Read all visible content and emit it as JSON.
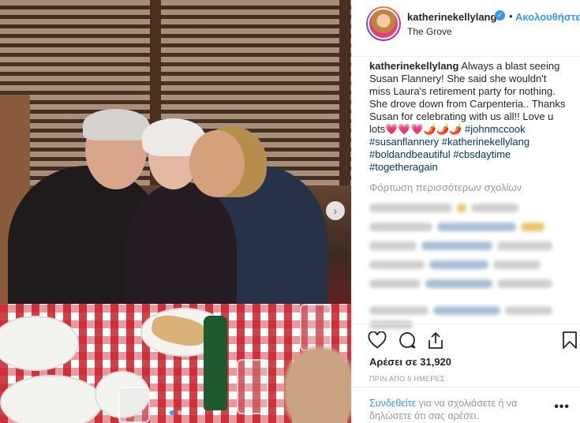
{
  "post": {
    "username": "katherinekellylang",
    "verified_mark": "✓",
    "separator": "•",
    "follow_label": "Ακολουθήστε",
    "location": "The Grove"
  },
  "caption": {
    "username": "katherinekellylang",
    "text": "Always a blast seeing Susan Flannery! She said she wouldn't miss Laura's retirement party for nothing. She drove down from Carpenteria.. Thanks Susan for celebrating with us all!! Love u lots",
    "emoji": "💗💗💗🌶️🌶️🌶️",
    "hashtags": [
      "#johnmccook",
      "#susanflannery",
      "#katherinekellylang",
      "#boldandbeautiful",
      "#cbsdaytime",
      "#togetheragain"
    ]
  },
  "comments": {
    "load_more_label": "Φόρτωση περισσότερων σχολίων"
  },
  "actions": {
    "like_icon": "heart-icon",
    "comment_icon": "comment-icon",
    "share_icon": "share-icon",
    "save_icon": "bookmark-icon"
  },
  "likes": "Αρέσει σε 31,920",
  "timestamp": "ΠΡΙΝ ΑΠΟ 5 ΗΜΕΡΕΣ",
  "login": {
    "link_label": "Συνδεθείτε",
    "text": " για να σχολιάσετε ή να δηλώσετε ότι σας αρέσει."
  },
  "more_options_label": "•••",
  "carousel": {
    "next_arrow": "›",
    "slide_count": 2,
    "active_slide": 1
  },
  "colors": {
    "link_blue": "#3897f0",
    "hashtag": "#003569",
    "muted": "#999999"
  }
}
